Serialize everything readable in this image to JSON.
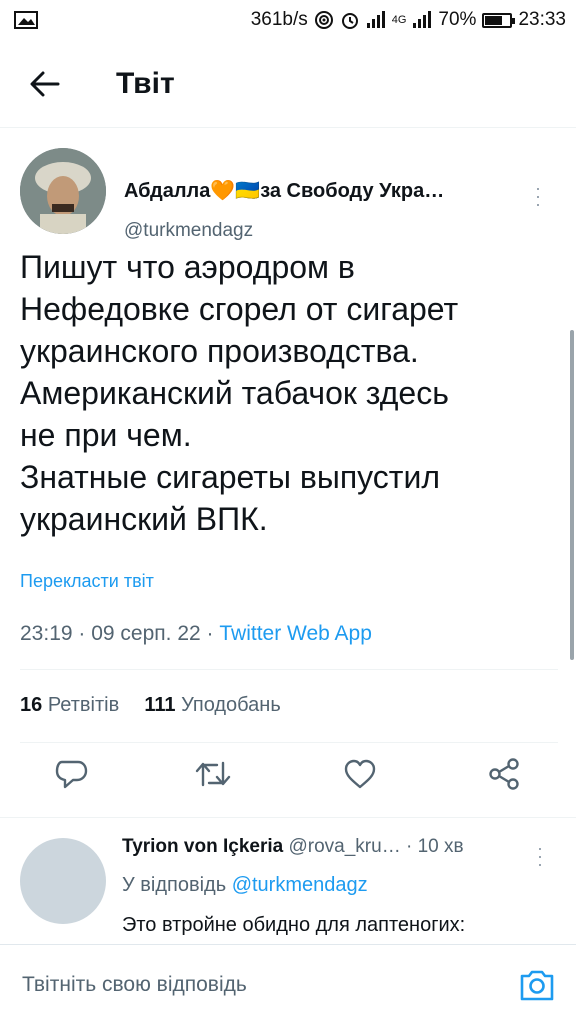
{
  "status_bar": {
    "speed": "361b/s",
    "network_small": "4G",
    "battery": "70%",
    "time": "23:33",
    "battery_level": 0.7
  },
  "header": {
    "title": "Твіт",
    "back_icon": "arrow-left-icon"
  },
  "tweet": {
    "author_name": "Абдалла🧡🇺🇦за Свободу Укра…",
    "author_handle": "@turkmendagz",
    "text": "Пишут что аэродром в\nНефедовке сгорел от сигарет\nукраинского производства.\nАмериканский табачок здесь\nне при чем.\nЗнатные сигареты выпустил\nукраинский ВПК.",
    "translate_label": "Перекласти твіт",
    "time": "23:19",
    "date": "09 серп. 22",
    "source": "Twitter Web App",
    "retweets_count": "16",
    "retweets_label": "Ретвітів",
    "likes_count": "111",
    "likes_label": "Уподобань",
    "actions": [
      "reply-icon",
      "retweet-icon",
      "like-icon",
      "share-icon"
    ]
  },
  "reply": {
    "author_name": "Tyrion von Içkeria",
    "author_handle": "@rova_kru…",
    "time": "· 10 хв",
    "replying_prefix": "У відповідь",
    "replying_to": "@turkmendagz",
    "text": "Это втройне обидно для лаптеногих:"
  },
  "compose": {
    "placeholder": "Твітніть свою відповідь"
  },
  "colors": {
    "accent": "#1d9bf0",
    "secondary_text": "#536471",
    "primary_text": "#0f1419"
  }
}
